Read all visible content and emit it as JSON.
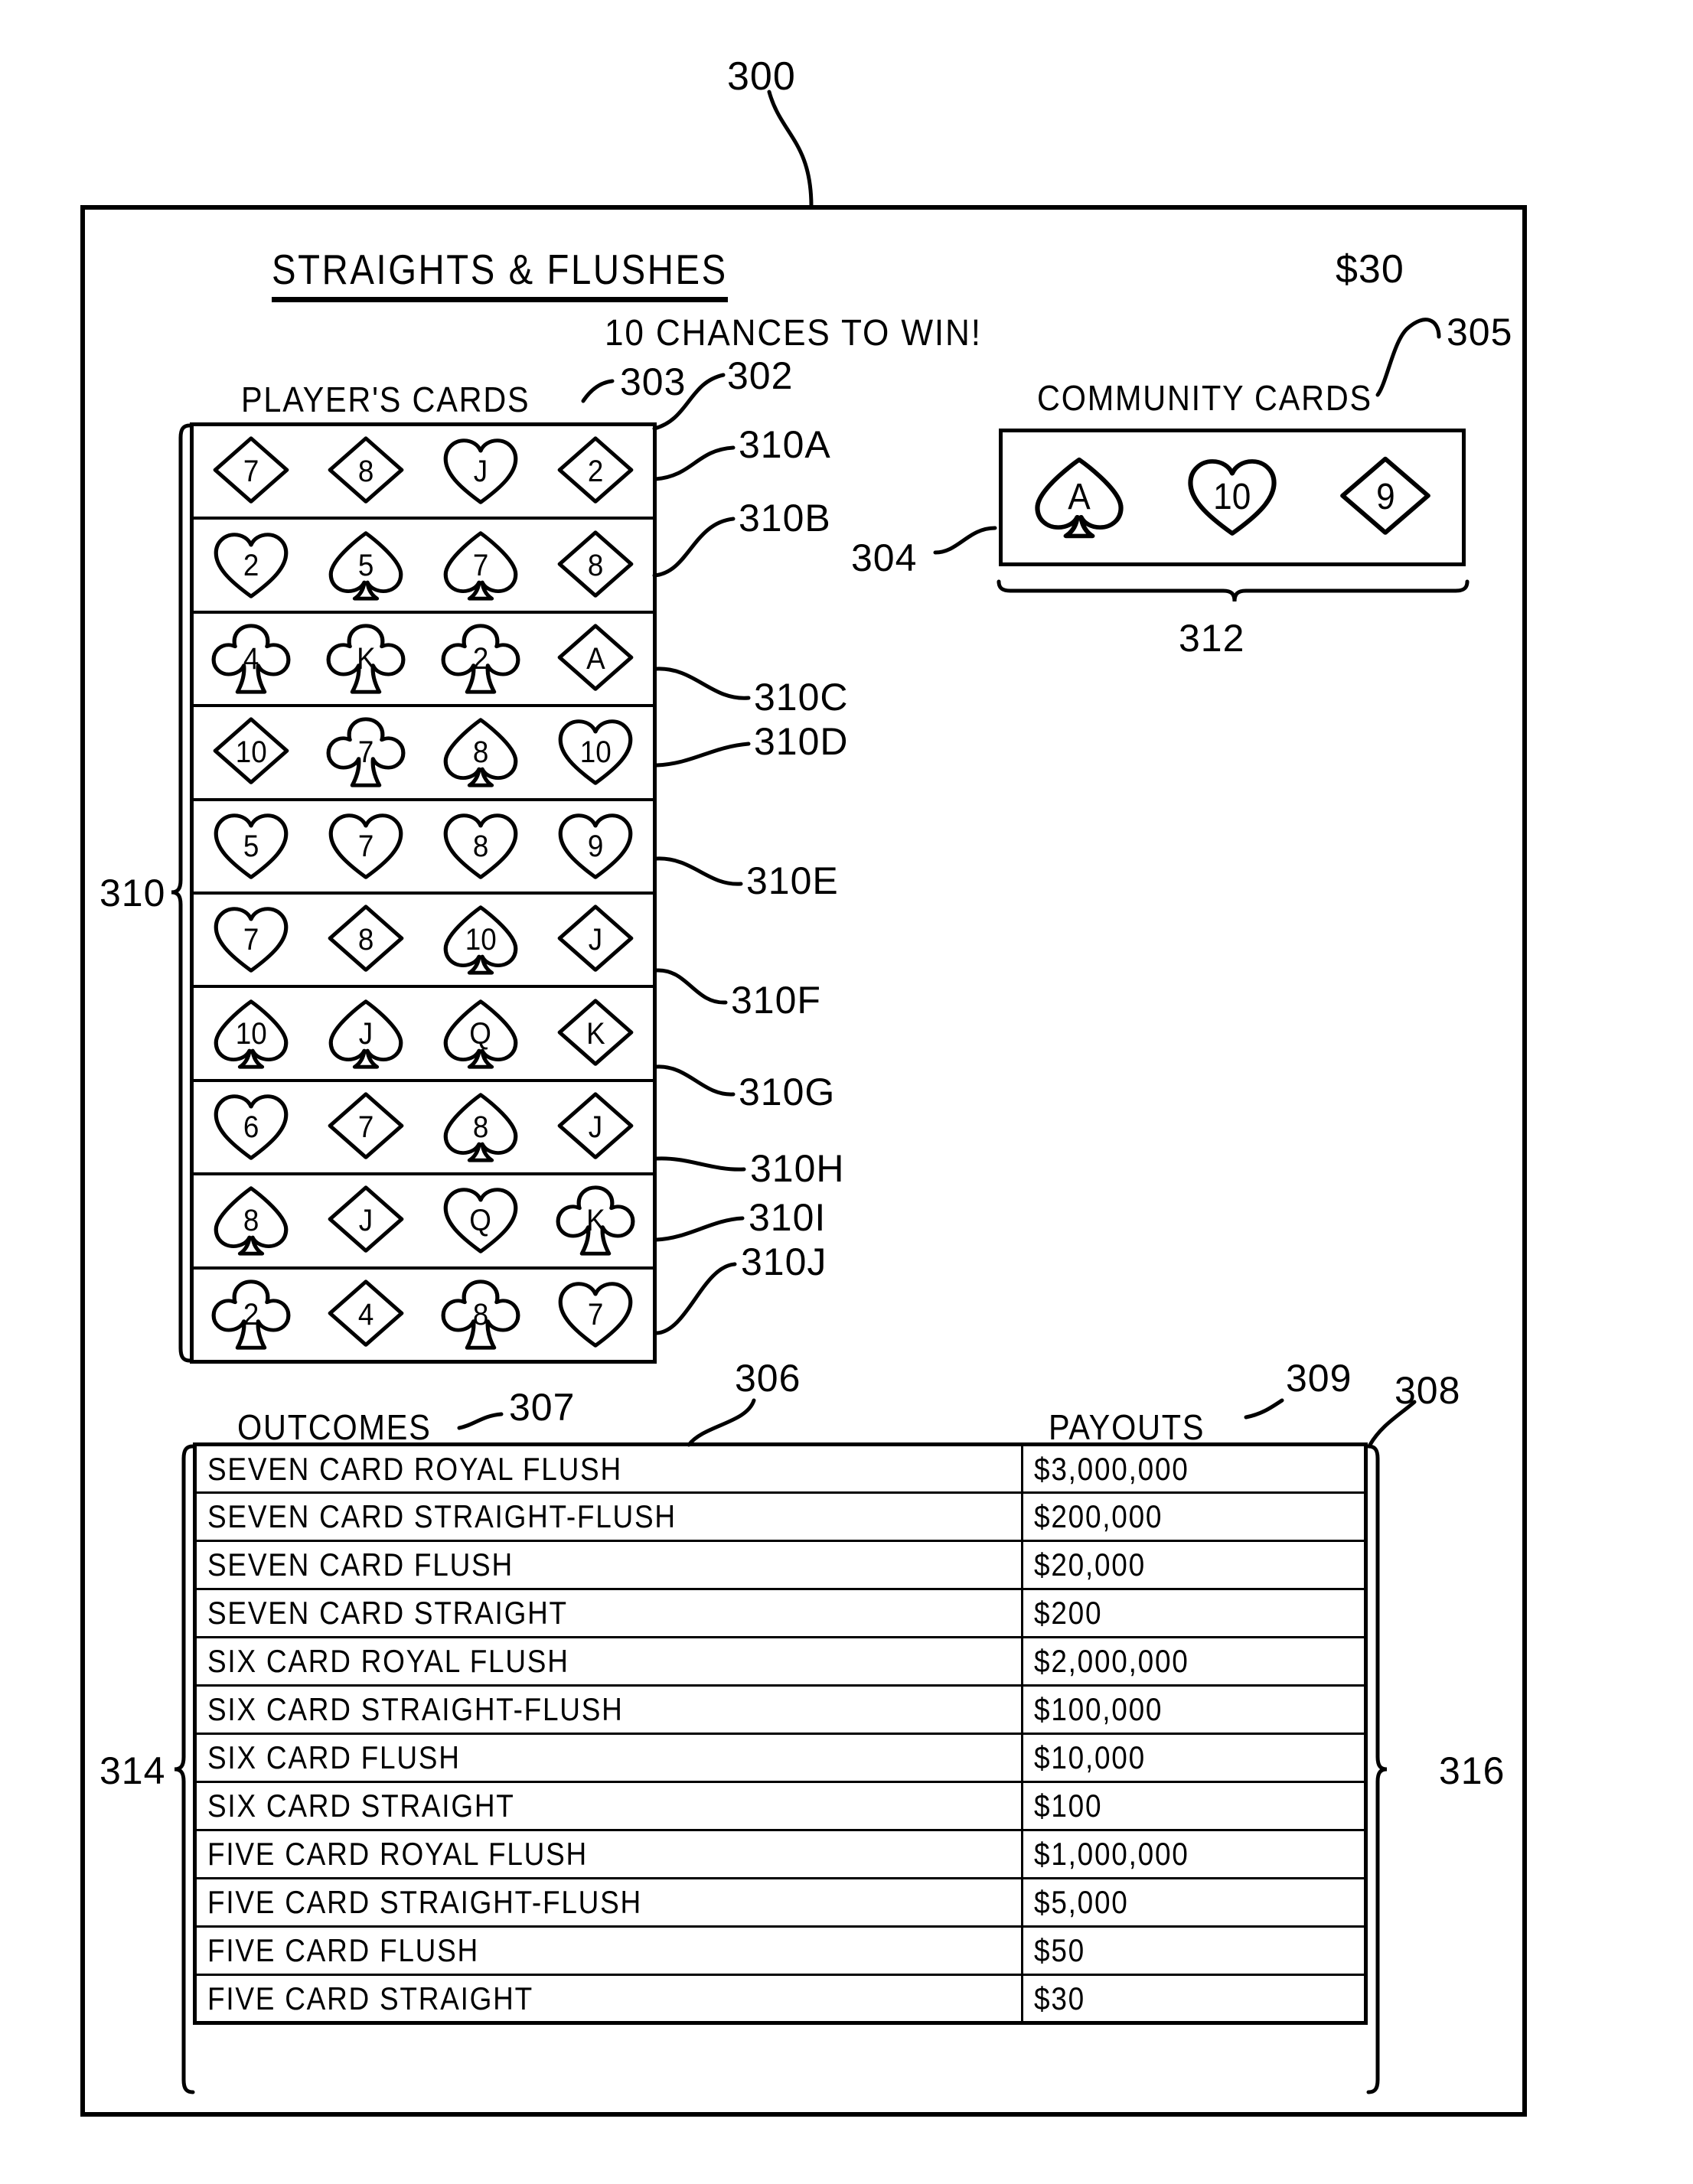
{
  "figure": {
    "number": "300"
  },
  "ticket": {
    "title": "STRAIGHTS & FLUSHES",
    "price": "$30",
    "chances": "10 CHANCES TO WIN!"
  },
  "players_section": {
    "caption": "PLAYER'S CARDS",
    "rows": [
      {
        "ref": "310A",
        "cards": [
          {
            "rank": "7",
            "suit": "diamond"
          },
          {
            "rank": "8",
            "suit": "diamond"
          },
          {
            "rank": "J",
            "suit": "heart"
          },
          {
            "rank": "2",
            "suit": "diamond"
          }
        ]
      },
      {
        "ref": "310B",
        "cards": [
          {
            "rank": "2",
            "suit": "heart"
          },
          {
            "rank": "5",
            "suit": "spade"
          },
          {
            "rank": "7",
            "suit": "spade"
          },
          {
            "rank": "8",
            "suit": "diamond"
          }
        ]
      },
      {
        "ref": "310C",
        "cards": [
          {
            "rank": "4",
            "suit": "club"
          },
          {
            "rank": "K",
            "suit": "club"
          },
          {
            "rank": "2",
            "suit": "club"
          },
          {
            "rank": "A",
            "suit": "diamond"
          }
        ]
      },
      {
        "ref": "310D",
        "cards": [
          {
            "rank": "10",
            "suit": "diamond"
          },
          {
            "rank": "7",
            "suit": "club"
          },
          {
            "rank": "8",
            "suit": "spade"
          },
          {
            "rank": "10",
            "suit": "heart"
          }
        ]
      },
      {
        "ref": "310E",
        "cards": [
          {
            "rank": "5",
            "suit": "heart"
          },
          {
            "rank": "7",
            "suit": "heart"
          },
          {
            "rank": "8",
            "suit": "heart"
          },
          {
            "rank": "9",
            "suit": "heart"
          }
        ]
      },
      {
        "ref": "310F",
        "cards": [
          {
            "rank": "7",
            "suit": "heart"
          },
          {
            "rank": "8",
            "suit": "diamond"
          },
          {
            "rank": "10",
            "suit": "spade"
          },
          {
            "rank": "J",
            "suit": "diamond"
          }
        ]
      },
      {
        "ref": "310G",
        "cards": [
          {
            "rank": "10",
            "suit": "spade"
          },
          {
            "rank": "J",
            "suit": "spade"
          },
          {
            "rank": "Q",
            "suit": "spade"
          },
          {
            "rank": "K",
            "suit": "diamond"
          }
        ]
      },
      {
        "ref": "310H",
        "cards": [
          {
            "rank": "6",
            "suit": "heart"
          },
          {
            "rank": "7",
            "suit": "diamond"
          },
          {
            "rank": "8",
            "suit": "spade"
          },
          {
            "rank": "J",
            "suit": "diamond"
          }
        ]
      },
      {
        "ref": "310I",
        "cards": [
          {
            "rank": "8",
            "suit": "spade"
          },
          {
            "rank": "J",
            "suit": "diamond"
          },
          {
            "rank": "Q",
            "suit": "heart"
          },
          {
            "rank": "K",
            "suit": "club"
          }
        ]
      },
      {
        "ref": "310J",
        "cards": [
          {
            "rank": "2",
            "suit": "club"
          },
          {
            "rank": "4",
            "suit": "diamond"
          },
          {
            "rank": "8",
            "suit": "club"
          },
          {
            "rank": "7",
            "suit": "heart"
          }
        ]
      }
    ]
  },
  "community_section": {
    "caption": "COMMUNITY CARDS",
    "cards": [
      {
        "rank": "A",
        "suit": "spade"
      },
      {
        "rank": "10",
        "suit": "heart"
      },
      {
        "rank": "9",
        "suit": "diamond"
      }
    ]
  },
  "paytable": {
    "outcomes_caption": "OUTCOMES",
    "payouts_caption": "PAYOUTS",
    "columns": [
      "OUTCOMES",
      "PAYOUTS"
    ],
    "rows": [
      {
        "outcome": "SEVEN CARD ROYAL FLUSH",
        "payout": "$3,000,000"
      },
      {
        "outcome": "SEVEN CARD STRAIGHT-FLUSH",
        "payout": "$200,000"
      },
      {
        "outcome": "SEVEN CARD FLUSH",
        "payout": "$20,000"
      },
      {
        "outcome": "SEVEN CARD STRAIGHT",
        "payout": "$200"
      },
      {
        "outcome": "SIX CARD ROYAL FLUSH",
        "payout": "$2,000,000"
      },
      {
        "outcome": "SIX CARD STRAIGHT-FLUSH",
        "payout": "$100,000"
      },
      {
        "outcome": "SIX CARD FLUSH",
        "payout": "$10,000"
      },
      {
        "outcome": "SIX CARD STRAIGHT",
        "payout": "$100"
      },
      {
        "outcome": "FIVE CARD ROYAL FLUSH",
        "payout": "$1,000,000"
      },
      {
        "outcome": "FIVE CARD STRAIGHT-FLUSH",
        "payout": "$5,000"
      },
      {
        "outcome": "FIVE CARD FLUSH",
        "payout": "$50"
      },
      {
        "outcome": "FIVE CARD STRAIGHT",
        "payout": "$30"
      }
    ]
  },
  "reference_numerals": {
    "fig": "300",
    "ticket_body": "302",
    "players_area": "303",
    "community_area": "304",
    "community_caption_ref": "305",
    "paytable_area": "306",
    "outcomes_ref": "307",
    "paytable_right": "308",
    "payouts_ref": "309",
    "rows_bracket": "310",
    "community_bracket": "312",
    "outcomes_bracket": "314",
    "payouts_bracket": "316",
    "row_a": "310A",
    "row_b": "310B",
    "row_c": "310C",
    "row_d": "310D",
    "row_e": "310E",
    "row_f": "310F",
    "row_g": "310G",
    "row_h": "310H",
    "row_i": "310I",
    "row_j": "310J"
  },
  "colors": {
    "ink": "#000000",
    "paper": "#ffffff"
  }
}
